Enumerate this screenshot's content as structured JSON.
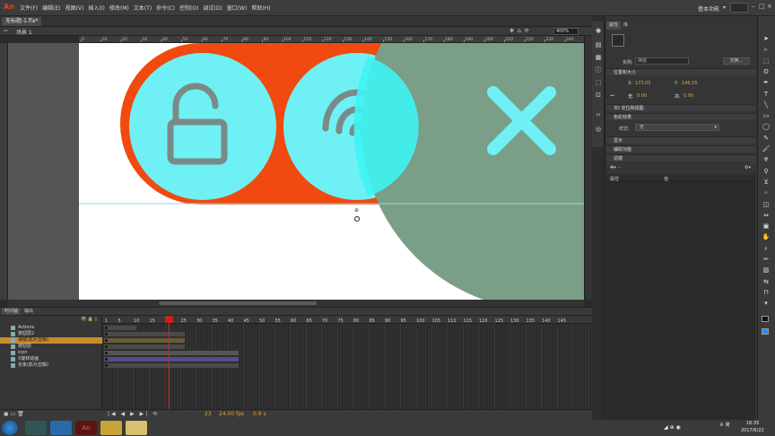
{
  "app": {
    "logo": "An"
  },
  "menu": [
    "文件(F)",
    "编辑(E)",
    "视图(V)",
    "插入(I)",
    "修改(M)",
    "文本(T)",
    "命令(C)",
    "控制(O)",
    "调试(D)",
    "窗口(W)",
    "帮助(H)"
  ],
  "workspace": {
    "label": "基本功能"
  },
  "document": {
    "tab": "无标题-1.fla*",
    "scene": "场景 1",
    "zoom": "400%"
  },
  "ruler": {
    "h_ticks": [
      "0",
      "10",
      "20",
      "30",
      "40",
      "50",
      "60",
      "70",
      "80",
      "90",
      "100",
      "110",
      "120",
      "130",
      "140",
      "150",
      "160",
      "170",
      "180",
      "190",
      "200",
      "210",
      "220",
      "230",
      "240",
      "250"
    ]
  },
  "stage": {
    "colors": {
      "orange": "#f04a10",
      "cyan": "#6ff0f4",
      "gray": "#7a7a7a",
      "green": "#7a9e88",
      "bright_cyan": "#3ef4f4"
    },
    "icons": [
      "unlock-icon",
      "fingerprint-icon",
      "close-x-icon"
    ]
  },
  "timeline": {
    "tabs": [
      "时间轴",
      "输出"
    ],
    "frame_numbers": [
      "1",
      "5",
      "10",
      "15",
      "20",
      "25",
      "30",
      "35",
      "40",
      "45",
      "50",
      "55",
      "60",
      "65",
      "70",
      "75",
      "80",
      "85",
      "90",
      "95",
      "100",
      "105",
      "110",
      "115",
      "120",
      "125",
      "130",
      "135",
      "140",
      "145"
    ],
    "layers": [
      {
        "name": "Actions",
        "selected": false
      },
      {
        "name": "按钮层2",
        "selected": false
      },
      {
        "name": "弹窗(影片剪辑)",
        "selected": true
      },
      {
        "name": "按钮层",
        "selected": false
      },
      {
        "name": "icon",
        "selected": false
      },
      {
        "name": "X旋转动画",
        "selected": false
      },
      {
        "name": "长条(影片剪辑)",
        "selected": false
      }
    ],
    "current_frame": "23",
    "fps": "24.00 fps",
    "time": "0.9 s"
  },
  "properties": {
    "tabs": [
      "属性",
      "库"
    ],
    "instance_label": "实例:",
    "instance_value": "弹窗",
    "swap_label": "交换...",
    "sections": {
      "position": "位置和大小",
      "threed": "3D 定位和视图",
      "color": "色彩效果",
      "display": "显示",
      "accessibility": "辅助功能",
      "filters": "滤镜"
    },
    "x_label": "X:",
    "x_value": "173.05",
    "y_label": "Y:",
    "y_value": "146.55",
    "w_label": "宽:",
    "w_value": "0.00",
    "h_label": "高:",
    "h_value": "0.00",
    "style_label": "样式:",
    "style_value": "无",
    "filter_cols": [
      "属性",
      "值"
    ]
  },
  "taskbar": {
    "time": "16:35",
    "date": "2017/6/22"
  }
}
